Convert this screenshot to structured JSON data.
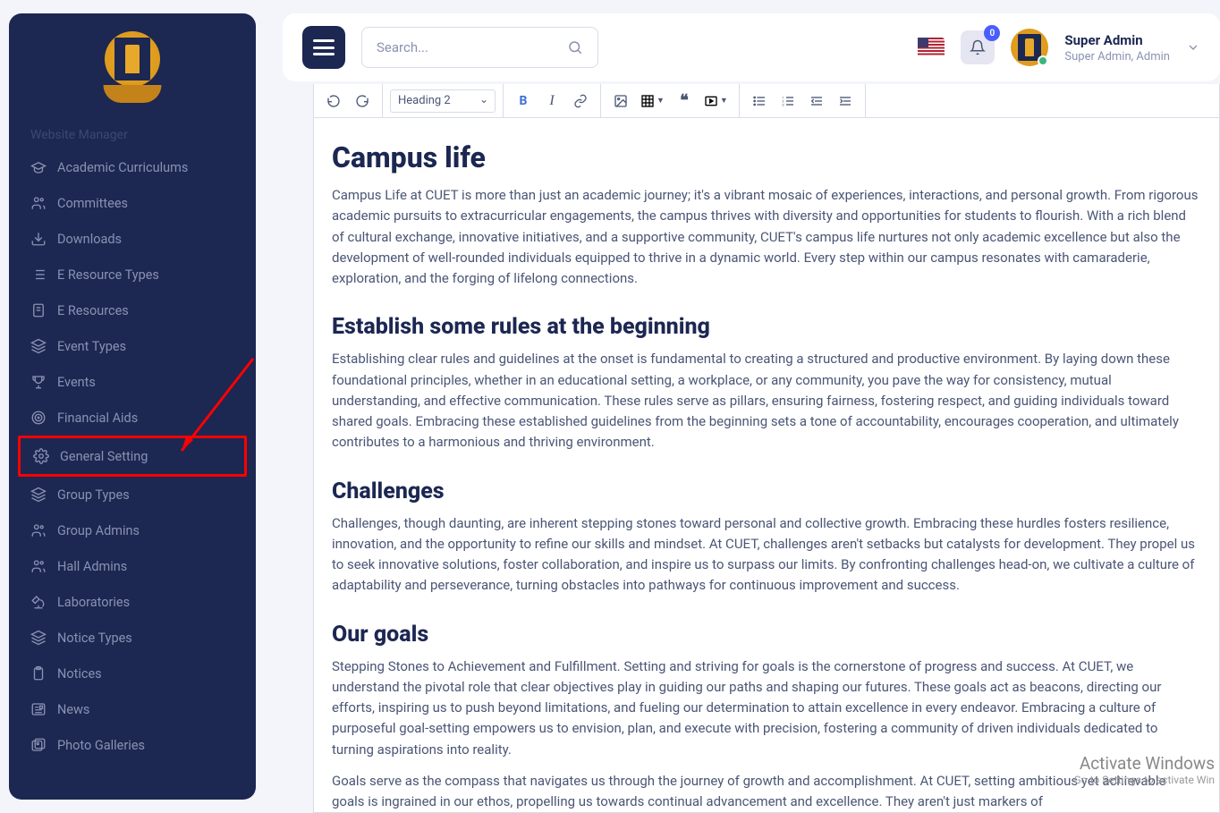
{
  "sidebar": {
    "faded_item": "Website Manager",
    "items": [
      {
        "icon": "grad-cap-icon",
        "label": "Academic Curriculums",
        "highlight": false
      },
      {
        "icon": "users-icon",
        "label": "Committees",
        "highlight": false
      },
      {
        "icon": "download-icon",
        "label": "Downloads",
        "highlight": false
      },
      {
        "icon": "list-icon",
        "label": "E Resource Types",
        "highlight": false
      },
      {
        "icon": "doc-icon",
        "label": "E Resources",
        "highlight": false
      },
      {
        "icon": "layers-icon",
        "label": "Event Types",
        "highlight": false
      },
      {
        "icon": "trophy-icon",
        "label": "Events",
        "highlight": false
      },
      {
        "icon": "target-icon",
        "label": "Financial Aids",
        "highlight": false
      },
      {
        "icon": "gear-icon",
        "label": "General Setting",
        "highlight": true
      },
      {
        "icon": "layers-icon",
        "label": "Group Types",
        "highlight": false
      },
      {
        "icon": "users-icon",
        "label": "Group Admins",
        "highlight": false
      },
      {
        "icon": "users-icon",
        "label": "Hall Admins",
        "highlight": false
      },
      {
        "icon": "microscope-icon",
        "label": "Laboratories",
        "highlight": false
      },
      {
        "icon": "layers-icon",
        "label": "Notice Types",
        "highlight": false
      },
      {
        "icon": "clipboard-icon",
        "label": "Notices",
        "highlight": false
      },
      {
        "icon": "news-icon",
        "label": "News",
        "highlight": false
      },
      {
        "icon": "gallery-icon",
        "label": "Photo Galleries",
        "highlight": false
      }
    ]
  },
  "topbar": {
    "search_placeholder": "Search...",
    "notif_count": "0",
    "user_name": "Super Admin",
    "user_role": "Super Admin, Admin"
  },
  "editor": {
    "toolbar": {
      "heading_value": "Heading 2"
    },
    "content": {
      "h1": "Campus life",
      "p1": "Campus Life at CUET is more than just an academic journey; it's a vibrant mosaic of experiences, interactions, and personal growth. From rigorous academic pursuits to extracurricular engagements, the campus thrives with diversity and opportunities for students to flourish. With a rich blend of cultural exchange, innovative initiatives, and a supportive community, CUET's campus life nurtures not only academic excellence but also the development of well-rounded individuals equipped to thrive in a dynamic world. Every step within our campus resonates with camaraderie, exploration, and the forging of lifelong connections.",
      "h2a": "Establish some rules at the beginning",
      "p2": "Establishing clear rules and guidelines at the onset is fundamental to creating a structured and productive environment. By laying down these foundational principles, whether in an educational setting, a workplace, or any community, you pave the way for consistency, mutual understanding, and effective communication. These rules serve as pillars, ensuring fairness, fostering respect, and guiding individuals toward shared goals. Embracing these established guidelines from the beginning sets a tone of accountability, encourages cooperation, and ultimately contributes to a harmonious and thriving environment.",
      "h2b": "Challenges",
      "p3": "Challenges, though daunting, are inherent stepping stones toward personal and collective growth. Embracing these hurdles fosters resilience, innovation, and the opportunity to refine our skills and mindset. At CUET, challenges aren't setbacks but catalysts for development. They propel us to seek innovative solutions, foster collaboration, and inspire us to surpass our limits. By confronting challenges head-on, we cultivate a culture of adaptability and perseverance, turning obstacles into pathways for continuous improvement and success.",
      "h2c": "Our goals",
      "p4": "Stepping Stones to Achievement and Fulfillment. Setting and striving for goals is the cornerstone of progress and success. At CUET, we understand the pivotal role that clear objectives play in guiding our paths and shaping our futures. These goals act as beacons, directing our efforts, inspiring us to push beyond limitations, and fueling our determination to attain excellence in every endeavor. Embracing a culture of purposeful goal-setting empowers us to envision, plan, and execute with precision, fostering a community of driven individuals dedicated to turning aspirations into reality.",
      "p5": "Goals serve as the compass that navigates us through the journey of growth and accomplishment. At CUET, setting ambitious yet achievable goals is ingrained in our ethos, propelling us towards continual advancement and excellence. They aren't just markers of"
    }
  },
  "watermark": {
    "line1": "Activate Windows",
    "line2": "Go to Settings to activate Win"
  }
}
